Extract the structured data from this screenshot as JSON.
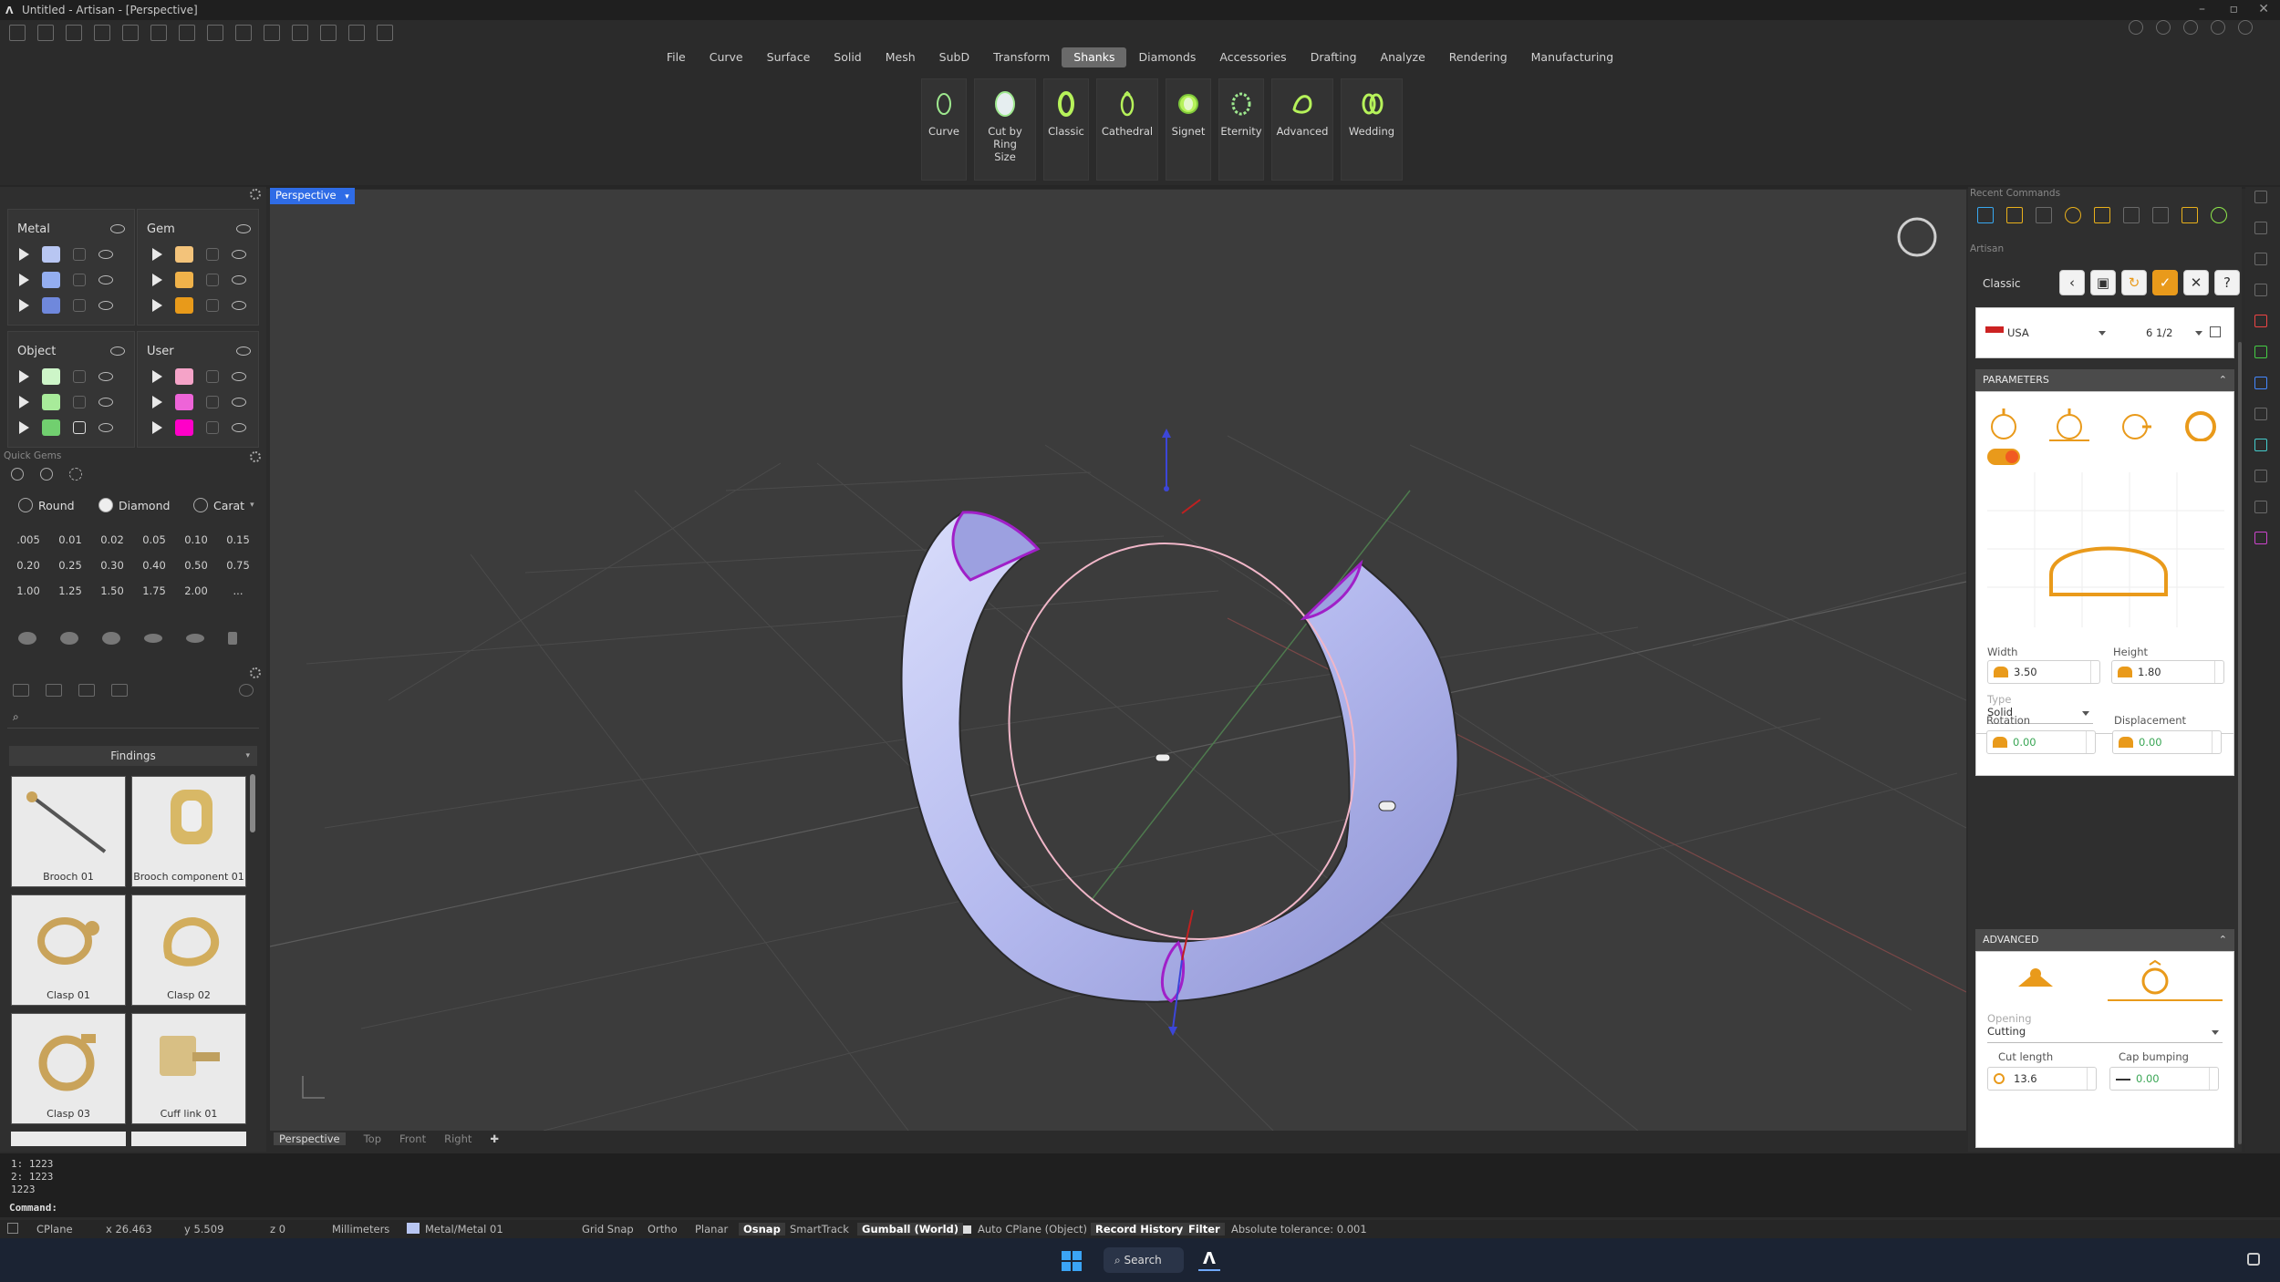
{
  "window": {
    "title": "Untitled - Artisan - [Perspective]"
  },
  "menu": {
    "items": [
      "File",
      "Curve",
      "Surface",
      "Solid",
      "Mesh",
      "SubD",
      "Transform",
      "Shanks",
      "Diamonds",
      "Accessories",
      "Drafting",
      "Analyze",
      "Rendering",
      "Manufacturing"
    ],
    "active": "Shanks"
  },
  "ribbon": {
    "buttons": [
      {
        "label1": "Curve",
        "label2": ""
      },
      {
        "label1": "Cut by Ring",
        "label2": "Size"
      },
      {
        "label1": "Classic",
        "label2": ""
      },
      {
        "label1": "Cathedral",
        "label2": ""
      },
      {
        "label1": "Signet",
        "label2": ""
      },
      {
        "label1": "Eternity",
        "label2": ""
      },
      {
        "label1": "Advanced",
        "label2": ""
      },
      {
        "label1": "Wedding",
        "label2": ""
      }
    ]
  },
  "layers": {
    "metal": {
      "title": "Metal",
      "colors": [
        "#b8c6f2",
        "#94aef0",
        "#6f88dc"
      ]
    },
    "gem": {
      "title": "Gem",
      "colors": [
        "#f3c37a",
        "#f0b24a",
        "#e89a1a"
      ]
    },
    "object": {
      "title": "Object",
      "colors": [
        "#cdf5c8",
        "#a8eb9a",
        "#71cf6f"
      ]
    },
    "user": {
      "title": "User",
      "colors": [
        "#f5a3c8",
        "#ee64d8",
        "#ff00c8"
      ]
    }
  },
  "quick_gems": {
    "title": "Quick Gems",
    "shape": "Round",
    "cut": "Diamond",
    "unit": "Carat",
    "carats": [
      ".005",
      "0.01",
      "0.02",
      "0.05",
      "0.10",
      "0.15",
      "0.20",
      "0.25",
      "0.30",
      "0.40",
      "0.50",
      "0.75",
      "1.00",
      "1.25",
      "1.50",
      "1.75",
      "2.00",
      "..."
    ]
  },
  "library": {
    "category": "Findings",
    "items": [
      "Brooch 01",
      "Brooch component 01",
      "Clasp 01",
      "Clasp 02",
      "Clasp 03",
      "Cuff link 01"
    ]
  },
  "viewport": {
    "name": "Perspective",
    "tabs": [
      "Perspective",
      "Top",
      "Front",
      "Right"
    ]
  },
  "recent_commands": {
    "title": "Recent Commands"
  },
  "artisan": {
    "title": "Artisan",
    "shank_type": "Classic",
    "ring_standard": "USA",
    "ring_size": "6 1/2",
    "parameters": {
      "header": "PARAMETERS",
      "width_label": "Width",
      "width": "3.50",
      "height_label": "Height",
      "height": "1.80",
      "type_label": "Type",
      "type": "Solid",
      "rotation_label": "Rotation",
      "rotation": "0.00",
      "displacement_label": "Displacement",
      "displacement": "0.00"
    },
    "advanced": {
      "header": "ADVANCED",
      "opening_label": "Opening",
      "opening": "Cutting",
      "cut_length_label": "Cut length",
      "cut_length": "13.6",
      "cap_bumping_label": "Cap bumping",
      "cap_bumping": "0.00"
    }
  },
  "command_history": [
    "1: 1223",
    "2: 1223",
    "1223"
  ],
  "command_prompt": "Command:",
  "status": {
    "cplane": "CPlane",
    "x": "x 26.463",
    "y": "y 5.509",
    "z": "z 0",
    "units": "Millimeters",
    "layer": "Metal/Metal 01",
    "grid_snap": "Grid Snap",
    "ortho": "Ortho",
    "planar": "Planar",
    "osnap": "Osnap",
    "smarttrack": "SmartTrack",
    "gumball": "Gumball (World)",
    "auto_cplane": "Auto CPlane (Object)",
    "record_history": "Record History",
    "filter": "Filter",
    "tolerance": "Absolute tolerance: 0.001"
  },
  "taskbar": {
    "search": "Search"
  },
  "colors": {
    "accent": "#e99a1b",
    "viewport_tab": "#2f6ce6",
    "ring": "#b7bdf2",
    "cut_edge": "#a020c8"
  }
}
